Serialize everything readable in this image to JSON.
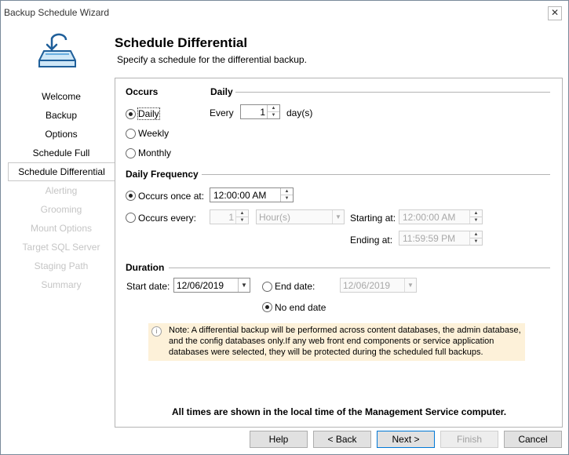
{
  "window": {
    "title": "Backup Schedule Wizard",
    "close_glyph": "✕"
  },
  "header": {
    "icon": "backup-drive-icon",
    "title": "Schedule Differential",
    "subtitle": "Specify a schedule for the differential backup."
  },
  "nav": {
    "items": [
      {
        "label": "Welcome",
        "state": "enabled"
      },
      {
        "label": "Backup",
        "state": "enabled"
      },
      {
        "label": "Options",
        "state": "enabled"
      },
      {
        "label": "Schedule Full",
        "state": "enabled"
      },
      {
        "label": "Schedule Differential",
        "state": "selected"
      },
      {
        "label": "Alerting",
        "state": "disabled"
      },
      {
        "label": "Grooming",
        "state": "disabled"
      },
      {
        "label": "Mount Options",
        "state": "disabled"
      },
      {
        "label": "Target SQL Server",
        "state": "disabled"
      },
      {
        "label": "Staging Path",
        "state": "disabled"
      },
      {
        "label": "Summary",
        "state": "disabled"
      }
    ]
  },
  "occurs": {
    "title": "Occurs",
    "options": [
      "Daily",
      "Weekly",
      "Monthly"
    ],
    "selected": "Daily"
  },
  "daily": {
    "title": "Daily",
    "every_label": "Every",
    "every_value": "1",
    "unit_label": "day(s)"
  },
  "frequency": {
    "title": "Daily Frequency",
    "once_label": "Occurs once at:",
    "once_value": "12:00:00 AM",
    "every_label": "Occurs every:",
    "every_value": "1",
    "every_unit": "Hour(s)",
    "starting_label": "Starting at:",
    "starting_value": "12:00:00 AM",
    "ending_label": "Ending at:",
    "ending_value": "11:59:59 PM",
    "selected": "once"
  },
  "duration": {
    "title": "Duration",
    "start_label": "Start date:",
    "start_value": "12/06/2019",
    "end_label": "End date:",
    "end_value": "12/06/2019",
    "no_end_label": "No end date",
    "selected": "no_end"
  },
  "note": {
    "icon": "info-icon",
    "text": "Note: A differential backup will be performed across content databases, the admin database, and the config databases only.If any web front end components or service application databases were selected, they will be protected during the scheduled full backups."
  },
  "footer_note": "All times are shown in the local time of the Management Service computer.",
  "buttons": {
    "help": "Help",
    "back": "< Back",
    "next": "Next >",
    "finish": "Finish",
    "cancel": "Cancel"
  }
}
